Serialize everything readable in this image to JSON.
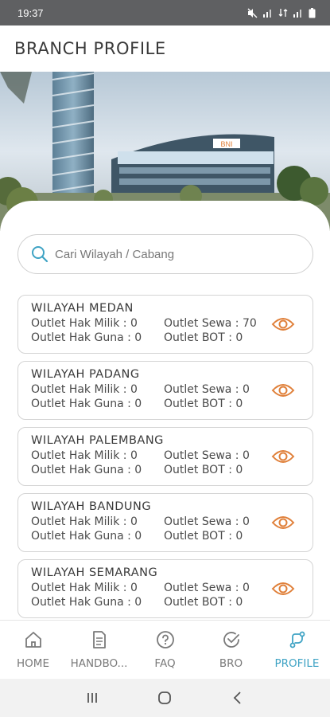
{
  "status_bar": {
    "time": "19:37"
  },
  "header": {
    "title": "BRANCH PROFILE"
  },
  "search": {
    "placeholder": "Cari Wilayah / Cabang"
  },
  "branches": [
    {
      "name": "WILAYAH  MEDAN",
      "hak_milik": "Outlet Hak Milik : 0",
      "sewa": "Outlet Sewa : 70",
      "hak_guna": "Outlet Hak Guna : 0",
      "bot": "Outlet BOT : 0"
    },
    {
      "name": "WILAYAH  PADANG",
      "hak_milik": "Outlet Hak Milik : 0",
      "sewa": "Outlet Sewa : 0",
      "hak_guna": "Outlet Hak Guna : 0",
      "bot": "Outlet BOT : 0"
    },
    {
      "name": "WILAYAH  PALEMBANG",
      "hak_milik": "Outlet Hak Milik : 0",
      "sewa": "Outlet Sewa : 0",
      "hak_guna": "Outlet Hak Guna : 0",
      "bot": "Outlet BOT : 0"
    },
    {
      "name": "WILAYAH  BANDUNG",
      "hak_milik": "Outlet Hak Milik : 0",
      "sewa": "Outlet Sewa : 0",
      "hak_guna": "Outlet Hak Guna : 0",
      "bot": "Outlet BOT : 0"
    },
    {
      "name": "WILAYAH  SEMARANG",
      "hak_milik": "Outlet Hak Milik : 0",
      "sewa": "Outlet Sewa : 0",
      "hak_guna": "Outlet Hak Guna : 0",
      "bot": "Outlet BOT : 0"
    }
  ],
  "hero": {
    "sign_text": "BNI"
  },
  "bottom_nav": [
    {
      "label": "HOME",
      "icon": "home-icon"
    },
    {
      "label": "HANDBO...",
      "icon": "document-icon"
    },
    {
      "label": "FAQ",
      "icon": "question-icon"
    },
    {
      "label": "BRO",
      "icon": "check-circle-icon"
    },
    {
      "label": "PROFILE",
      "icon": "branch-route-icon"
    }
  ],
  "colors": {
    "accent": "#3fa3c4",
    "eye_icon": "#e0803a",
    "status_bar": "#5f6062",
    "system_nav": "#f2f2f2"
  }
}
